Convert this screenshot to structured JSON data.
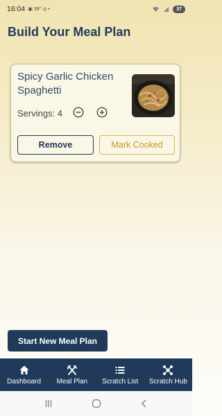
{
  "status_bar": {
    "time": "16:04",
    "indicators": "▣ 39° ◎ •",
    "battery": "37"
  },
  "page": {
    "title": "Build Your Meal Plan"
  },
  "meal_card": {
    "recipe_title": "Spicy Garlic Chicken Spaghetti",
    "servings_label": "Servings: 4",
    "servings": 4,
    "remove_label": "Remove",
    "mark_cooked_label": "Mark Cooked"
  },
  "start_button_label": "Start New Meal Plan",
  "bottom_nav": {
    "items": [
      {
        "label": "Dashboard",
        "icon": "home-icon"
      },
      {
        "label": "Meal Plan",
        "icon": "fork-knife-icon"
      },
      {
        "label": "Scratch List",
        "icon": "list-icon"
      },
      {
        "label": "Scratch Hub",
        "icon": "hub-icon"
      }
    ]
  },
  "system_nav": {
    "icons": [
      "recents-icon",
      "home-circle-icon",
      "back-icon"
    ]
  },
  "colors": {
    "primary": "#1f3a5a",
    "accent": "#c8961c",
    "card_bg": "#fbf7e6"
  }
}
